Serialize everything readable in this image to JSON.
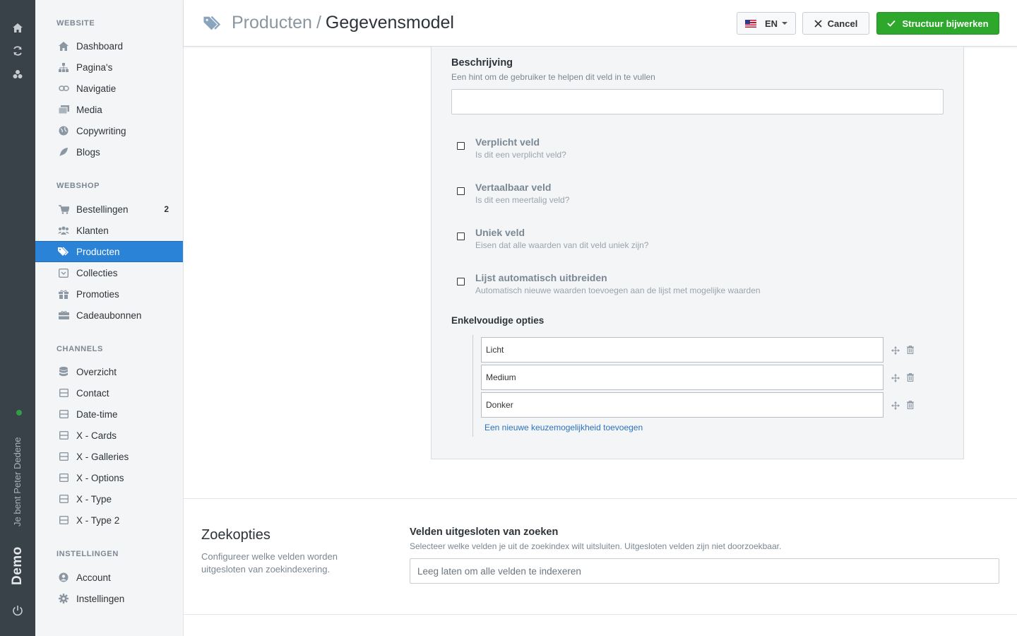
{
  "rail": {
    "user_text": "Je bent Peter Dedene",
    "brand": "Demo",
    "status_color": "#2f9e44"
  },
  "sidebar": {
    "sections": [
      {
        "title": "WEBSITE",
        "items": [
          {
            "label": "Dashboard",
            "icon": "home-icon"
          },
          {
            "label": "Pagina's",
            "icon": "sitemap-icon"
          },
          {
            "label": "Navigatie",
            "icon": "link-icon"
          },
          {
            "label": "Media",
            "icon": "images-icon"
          },
          {
            "label": "Copywriting",
            "icon": "globe-icon"
          },
          {
            "label": "Blogs",
            "icon": "feather-icon"
          }
        ]
      },
      {
        "title": "WEBSHOP",
        "items": [
          {
            "label": "Bestellingen",
            "icon": "cart-icon",
            "badge": "2"
          },
          {
            "label": "Klanten",
            "icon": "users-icon"
          },
          {
            "label": "Producten",
            "icon": "tags-icon",
            "active": true
          },
          {
            "label": "Collecties",
            "icon": "inbox-icon"
          },
          {
            "label": "Promoties",
            "icon": "gift-icon"
          },
          {
            "label": "Cadeaubonnen",
            "icon": "giftcard-icon"
          }
        ]
      },
      {
        "title": "CHANNELS",
        "items": [
          {
            "label": "Overzicht",
            "icon": "database-icon"
          },
          {
            "label": "Contact",
            "icon": "window-icon"
          },
          {
            "label": "Date-time",
            "icon": "window-icon"
          },
          {
            "label": "X - Cards",
            "icon": "window-icon"
          },
          {
            "label": "X - Galleries",
            "icon": "window-icon"
          },
          {
            "label": "X - Options",
            "icon": "window-icon"
          },
          {
            "label": "X - Type",
            "icon": "window-icon"
          },
          {
            "label": "X - Type 2",
            "icon": "window-icon"
          }
        ]
      },
      {
        "title": "INSTELLINGEN",
        "items": [
          {
            "label": "Account",
            "icon": "user-circle-icon"
          },
          {
            "label": "Instellingen",
            "icon": "gear-icon"
          }
        ]
      }
    ]
  },
  "header": {
    "crumb": "Producten",
    "separator": "/",
    "title": "Gegevensmodel",
    "lang": "EN",
    "cancel_label": "Cancel",
    "save_label": "Structuur bijwerken",
    "save_color": "#2da82d"
  },
  "panel": {
    "description": {
      "label": "Beschrijving",
      "hint": "Een hint om de gebruiker te helpen dit veld in te vullen",
      "value": ""
    },
    "checkboxes": [
      {
        "label": "Verplicht veld",
        "hint": "Is dit een verplicht veld?",
        "checked": false
      },
      {
        "label": "Vertaalbaar veld",
        "hint": "Is dit een meertalig veld?",
        "checked": false
      },
      {
        "label": "Uniek veld",
        "hint": "Eisen dat alle waarden van dit veld uniek zijn?",
        "checked": false
      },
      {
        "label": "Lijst automatisch uitbreiden",
        "hint": "Automatisch nieuwe waarden toevoegen aan de lijst met mogelijke waarden",
        "checked": false
      }
    ],
    "options": {
      "label": "Enkelvoudige opties",
      "values": [
        "Licht",
        "Medium",
        "Donker"
      ],
      "add_label": "Een nieuwe keuzemogelijkheid toevoegen"
    }
  },
  "search": {
    "title": "Zoekopties",
    "description": "Configureer welke velden worden uitgesloten van zoekindexering.",
    "field_label": "Velden uitgesloten van zoeken",
    "field_hint": "Selecteer welke velden je uit de zoekindex wilt uitsluiten. Uitgesloten velden zijn niet doorzoekbaar.",
    "placeholder": "Leeg laten om alle velden te indexeren"
  }
}
